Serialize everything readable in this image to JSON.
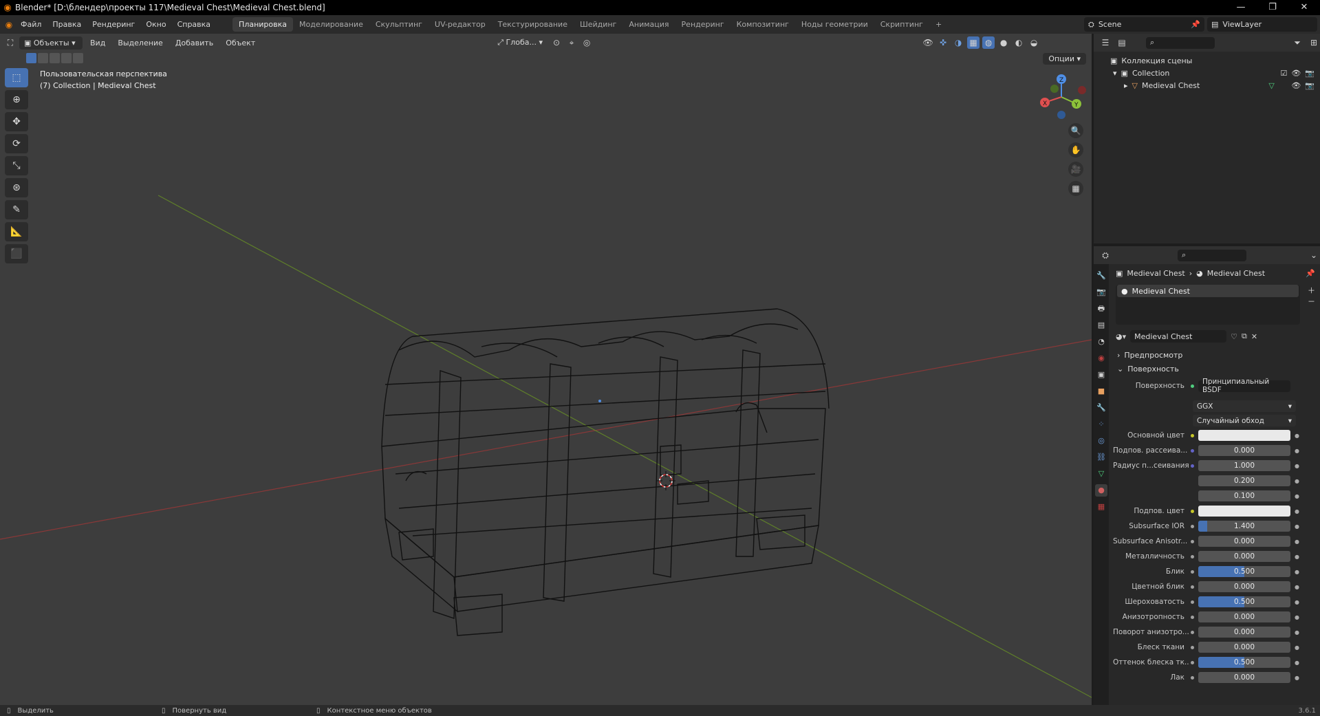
{
  "title_bar": {
    "title": "Blender* [D:\\блендер\\проекты 117\\Medieval Chest\\Medieval Chest.blend]"
  },
  "menu": {
    "items": [
      "Файл",
      "Правка",
      "Рендеринг",
      "Окно",
      "Справка"
    ],
    "workspaces": [
      "Планировка",
      "Моделирование",
      "Скульптинг",
      "UV-редактор",
      "Текстурирование",
      "Шейдинг",
      "Анимация",
      "Рендеринг",
      "Композитинг",
      "Ноды геометрии",
      "Скриптинг"
    ],
    "active_workspace": "Планировка",
    "add_tab": "+",
    "scene": "Scene",
    "view_layer": "ViewLayer"
  },
  "viewport": {
    "mode": "Объекты",
    "menus": [
      "Вид",
      "Выделение",
      "Добавить",
      "Объект"
    ],
    "orientation": "Глоба...",
    "options": "Опции",
    "view_name": "Пользовательская перспектива",
    "object_info": "(7) Collection | Medieval Chest",
    "gizmo": {
      "x": "X",
      "y": "Y",
      "z": "Z"
    },
    "icons": [
      "cursor-icon",
      "move-icon",
      "rotate-icon",
      "scale-icon",
      "transform-icon",
      "annotate-icon",
      "measure-icon",
      "add-cube-icon"
    ]
  },
  "outliner": {
    "scene_collection": "Коллекция сцены",
    "collection": "Collection",
    "object": "Medieval Chest"
  },
  "properties": {
    "breadcrumb": [
      "Medieval Chest",
      "Medieval Chest"
    ],
    "slot": "Medieval Chest",
    "material": "Medieval Chest",
    "panel_preview": "Предпросмотр",
    "panel_surface": "Поверхность",
    "surface_label": "Поверхность",
    "surface_value": "Принципиальный BSDF",
    "distribution": "GGX",
    "subsurface_method": "Случайный обход",
    "rows": [
      {
        "label": "Основной цвет",
        "value": "",
        "type": "color",
        "sock": "#c7c729"
      },
      {
        "label": "Подпов. рассеива...",
        "value": "0.000",
        "type": "num",
        "fill": 0,
        "sock": "#6363c7"
      },
      {
        "label": "Радиус п...сеивания",
        "value": "1.000",
        "type": "num",
        "fill": 0,
        "sock": "#6363c7"
      },
      {
        "label": "",
        "value": "0.200",
        "type": "num",
        "fill": 0,
        "sock": ""
      },
      {
        "label": "",
        "value": "0.100",
        "type": "num",
        "fill": 0,
        "sock": ""
      },
      {
        "label": "Подпов. цвет",
        "value": "",
        "type": "color",
        "sock": "#c7c729"
      },
      {
        "label": "Subsurface IOR",
        "value": "1.400",
        "type": "num",
        "fill": 0.1,
        "sock": "#a1a1a1"
      },
      {
        "label": "Subsurface Anisotr...",
        "value": "0.000",
        "type": "num",
        "fill": 0,
        "sock": "#a1a1a1"
      },
      {
        "label": "Металличность",
        "value": "0.000",
        "type": "num",
        "fill": 0,
        "sock": "#a1a1a1"
      },
      {
        "label": "Блик",
        "value": "0.500",
        "type": "num",
        "fill": 0.5,
        "sock": "#a1a1a1"
      },
      {
        "label": "Цветной блик",
        "value": "0.000",
        "type": "num",
        "fill": 0,
        "sock": "#a1a1a1"
      },
      {
        "label": "Шероховатость",
        "value": "0.500",
        "type": "num",
        "fill": 0.5,
        "sock": "#a1a1a1"
      },
      {
        "label": "Анизотропность",
        "value": "0.000",
        "type": "num",
        "fill": 0,
        "sock": "#a1a1a1"
      },
      {
        "label": "Поворот анизотро...",
        "value": "0.000",
        "type": "num",
        "fill": 0,
        "sock": "#a1a1a1"
      },
      {
        "label": "Блеск ткани",
        "value": "0.000",
        "type": "num",
        "fill": 0,
        "sock": "#a1a1a1"
      },
      {
        "label": "Оттенок блеска тк...",
        "value": "0.500",
        "type": "num",
        "fill": 0.5,
        "sock": "#a1a1a1"
      },
      {
        "label": "Лак",
        "value": "0.000",
        "type": "num",
        "fill": 0,
        "sock": "#a1a1a1"
      }
    ]
  },
  "status_bar": {
    "select": "Выделить",
    "rotate": "Повернуть вид",
    "context": "Контекстное меню объектов",
    "version": "3.6.1"
  },
  "colors": {
    "accent": "#4772b3",
    "x_axis": "#9a3a3a",
    "y_axis": "#6a8a2a",
    "gizmo_x": "#e05050",
    "gizmo_y": "#8cc23a",
    "gizmo_z": "#4f8fe6"
  }
}
